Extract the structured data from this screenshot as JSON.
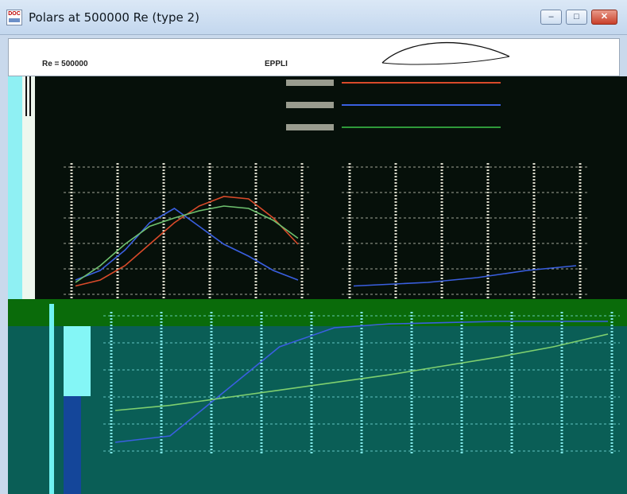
{
  "window": {
    "title": "Polars at 500000 Re (type 2)",
    "icon_label": "DOC",
    "buttons": {
      "minimize": "–",
      "maximize": "□",
      "close": "✕"
    }
  },
  "header": {
    "reynolds": "Re = 500000",
    "airfoil": "EPPLI"
  },
  "legend": [
    {
      "color": "#d94a2a"
    },
    {
      "color": "#3a5fe0"
    },
    {
      "color": "#2f9a3a"
    }
  ],
  "colors": {
    "black_area": "#06100a",
    "green_band": "#0a6b0a",
    "teal_area": "#0a5e56"
  },
  "chart_data": [
    {
      "type": "line",
      "title": "",
      "xlabel": "",
      "ylabel": "",
      "grid": true,
      "series": [
        {
          "values": [
            0.05,
            0.1,
            0.22,
            0.4,
            0.58,
            0.72,
            0.8,
            0.78,
            0.62,
            0.4
          ]
        },
        {
          "values": [
            0.1,
            0.18,
            0.35,
            0.58,
            0.7,
            0.55,
            0.4,
            0.3,
            0.18,
            0.1
          ]
        },
        {
          "values": [
            0.08,
            0.22,
            0.4,
            0.55,
            0.62,
            0.68,
            0.72,
            0.7,
            0.6,
            0.45
          ]
        }
      ]
    },
    {
      "type": "line",
      "title": "",
      "xlabel": "",
      "ylabel": "",
      "grid": true,
      "series": [
        {
          "values": [
            0.05,
            0.06,
            0.07,
            0.08,
            0.1,
            0.12,
            0.15,
            0.18,
            0.2,
            0.22
          ]
        }
      ]
    },
    {
      "type": "line",
      "title": "",
      "xlabel": "",
      "ylabel": "",
      "grid": true,
      "series": [
        {
          "values": [
            0.05,
            0.1,
            0.45,
            0.8,
            0.95,
            0.98,
            0.99,
            1.0,
            1.0,
            1.0
          ]
        },
        {
          "values": [
            0.3,
            0.34,
            0.4,
            0.46,
            0.52,
            0.58,
            0.65,
            0.72,
            0.8,
            0.9
          ]
        }
      ]
    }
  ]
}
